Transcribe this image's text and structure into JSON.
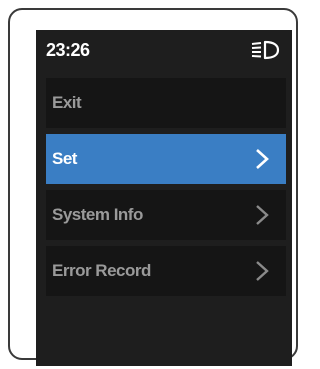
{
  "status_bar": {
    "time": "23:26",
    "headlight_icon": "headlight-on-icon"
  },
  "menu": {
    "items": [
      {
        "label": "Exit",
        "selected": false,
        "has_arrow": false
      },
      {
        "label": "Set",
        "selected": true,
        "has_arrow": true
      },
      {
        "label": "System Info",
        "selected": false,
        "has_arrow": true
      },
      {
        "label": "Error Record",
        "selected": false,
        "has_arrow": true
      }
    ]
  },
  "colors": {
    "background": "#1e1e1e",
    "item_background": "#151515",
    "selected": "#3a7ec4",
    "text_selected": "#ffffff",
    "text_normal": "#9a9a9a"
  }
}
